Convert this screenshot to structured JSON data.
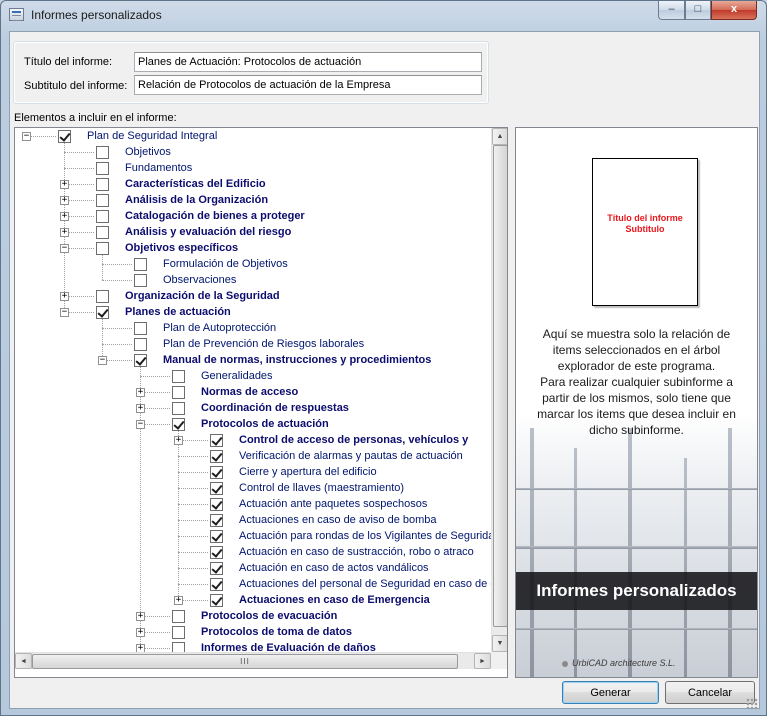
{
  "window": {
    "title": "Informes personalizados"
  },
  "caption_buttons": {
    "minimize": "–",
    "maximize": "□",
    "close": "x"
  },
  "form": {
    "title_label": "Título del informe:",
    "title_value": "Planes de Actuación: Protocolos de actuación",
    "subtitle_label": "Subtitulo del informe:",
    "subtitle_value": "Relación de Protocolos de actuación de la Empresa"
  },
  "tree": {
    "section_label": "Elementos a incluir en el informe:",
    "nodes": [
      {
        "label": "Plan de Seguridad Integral",
        "level": 0,
        "bold": false,
        "checked": true,
        "expander": "-"
      },
      {
        "label": "Objetivos",
        "level": 1,
        "bold": false,
        "checked": false,
        "expander": ""
      },
      {
        "label": "Fundamentos",
        "level": 1,
        "bold": false,
        "checked": false,
        "expander": ""
      },
      {
        "label": "Características del Edificio",
        "level": 1,
        "bold": true,
        "checked": false,
        "expander": "+"
      },
      {
        "label": "Análisis de la Organización",
        "level": 1,
        "bold": true,
        "checked": false,
        "expander": "+"
      },
      {
        "label": "Catalogación de bienes a proteger",
        "level": 1,
        "bold": true,
        "checked": false,
        "expander": "+"
      },
      {
        "label": "Análisis y evaluación del riesgo",
        "level": 1,
        "bold": true,
        "checked": false,
        "expander": "+"
      },
      {
        "label": "Objetivos específicos",
        "level": 1,
        "bold": true,
        "checked": false,
        "expander": "-"
      },
      {
        "label": "Formulación de Objetivos",
        "level": 2,
        "bold": false,
        "checked": false,
        "expander": ""
      },
      {
        "label": "Observaciones",
        "level": 2,
        "bold": false,
        "checked": false,
        "expander": ""
      },
      {
        "label": "Organización de la Seguridad",
        "level": 1,
        "bold": true,
        "checked": false,
        "expander": "+"
      },
      {
        "label": "Planes de actuación",
        "level": 1,
        "bold": true,
        "checked": true,
        "expander": "-"
      },
      {
        "label": "Plan de Autoprotección",
        "level": 2,
        "bold": false,
        "checked": false,
        "expander": ""
      },
      {
        "label": "Plan de Prevención de Riesgos laborales",
        "level": 2,
        "bold": false,
        "checked": false,
        "expander": ""
      },
      {
        "label": "Manual de normas, instrucciones y procedimientos",
        "level": 2,
        "bold": true,
        "checked": true,
        "expander": "-"
      },
      {
        "label": "Generalidades",
        "level": 3,
        "bold": false,
        "checked": false,
        "expander": ""
      },
      {
        "label": "Normas de acceso",
        "level": 3,
        "bold": true,
        "checked": false,
        "expander": "+"
      },
      {
        "label": "Coordinación de respuestas",
        "level": 3,
        "bold": true,
        "checked": false,
        "expander": "+"
      },
      {
        "label": "Protocolos de actuación",
        "level": 3,
        "bold": true,
        "checked": true,
        "expander": "-"
      },
      {
        "label": "Control de acceso de personas, vehículos y",
        "level": 4,
        "bold": true,
        "checked": true,
        "expander": "+"
      },
      {
        "label": "Verificación de alarmas y pautas de actuación",
        "level": 4,
        "bold": false,
        "checked": true,
        "expander": ""
      },
      {
        "label": "Cierre y apertura del edificio",
        "level": 4,
        "bold": false,
        "checked": true,
        "expander": ""
      },
      {
        "label": "Control de llaves (maestramiento)",
        "level": 4,
        "bold": false,
        "checked": true,
        "expander": ""
      },
      {
        "label": "Actuación ante paquetes sospechosos",
        "level": 4,
        "bold": false,
        "checked": true,
        "expander": ""
      },
      {
        "label": "Actuaciones en caso de aviso de bomba",
        "level": 4,
        "bold": false,
        "checked": true,
        "expander": ""
      },
      {
        "label": "Actuación para rondas de los Vigilantes de Segurida",
        "level": 4,
        "bold": false,
        "checked": true,
        "expander": ""
      },
      {
        "label": "Actuación en caso de sustracción, robo o atraco",
        "level": 4,
        "bold": false,
        "checked": true,
        "expander": ""
      },
      {
        "label": "Actuación en caso de actos vandálicos",
        "level": 4,
        "bold": false,
        "checked": true,
        "expander": ""
      },
      {
        "label": "Actuaciones del personal de Seguridad en caso de e",
        "level": 4,
        "bold": false,
        "checked": true,
        "expander": ""
      },
      {
        "label": "Actuaciones en caso de Emergencia",
        "level": 4,
        "bold": true,
        "checked": true,
        "expander": "+"
      },
      {
        "label": "Protocolos de evacuación",
        "level": 3,
        "bold": true,
        "checked": false,
        "expander": "+"
      },
      {
        "label": "Protocolos de toma de datos",
        "level": 3,
        "bold": true,
        "checked": false,
        "expander": "+"
      },
      {
        "label": "Informes de Evaluación de daños",
        "level": 3,
        "bold": true,
        "checked": false,
        "expander": "+"
      }
    ],
    "hscroll_grip": "III",
    "scroll_up": "▲",
    "scroll_down": "▼",
    "scroll_left": "◄",
    "scroll_right": "►"
  },
  "preview": {
    "doc_title": "Título del informe",
    "doc_subtitle": "Subtitulo",
    "description_lines": [
      "Aquí se muestra solo la relación de",
      "items seleccionados en el árbol",
      "explorador de este programa.",
      "Para realizar cualquier subinforme a",
      "partir de los mismos, solo tiene que",
      "marcar los items que desea incluir en",
      "dicho subinforme."
    ],
    "banner": "Informes personalizados",
    "brand": "UrbiCAD architecture S.L."
  },
  "buttons": {
    "generate": "Generar",
    "cancel": "Cancelar"
  }
}
